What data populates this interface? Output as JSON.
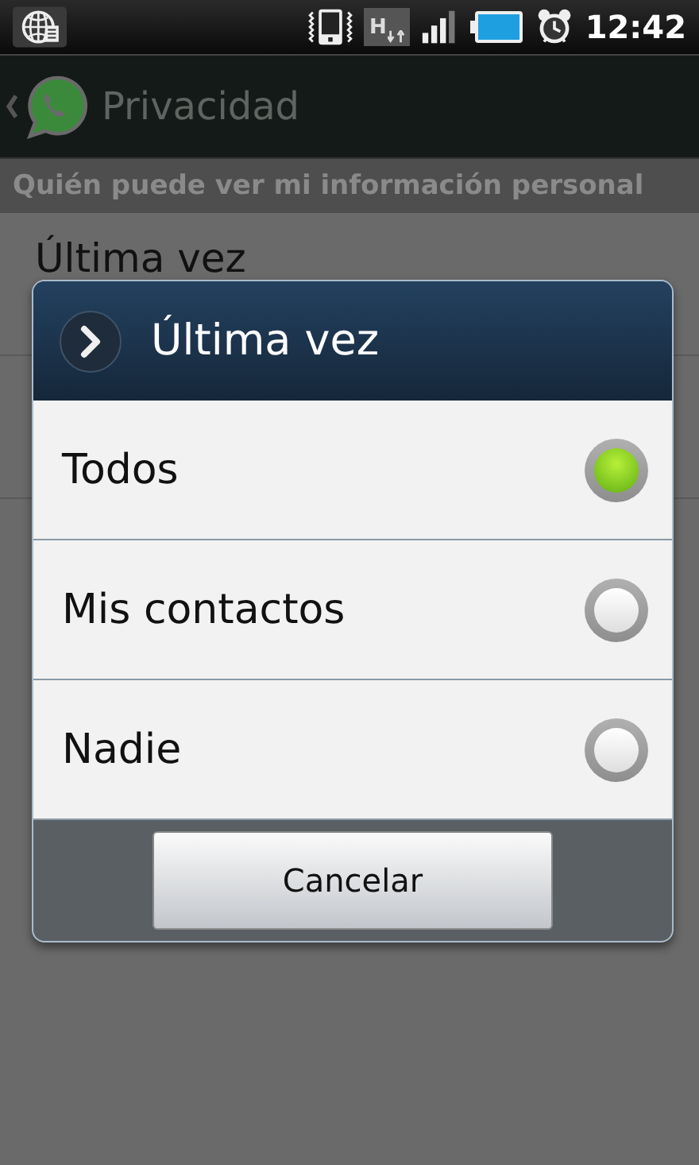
{
  "status_bar": {
    "network_type": "H",
    "time": "12:42"
  },
  "action_bar": {
    "title": "Privacidad"
  },
  "section": {
    "header": "Quién puede ver mi información personal"
  },
  "settings": [
    {
      "label": "Última vez"
    }
  ],
  "dialog": {
    "title": "Última vez",
    "options": [
      {
        "label": "Todos",
        "selected": true
      },
      {
        "label": "Mis contactos",
        "selected": false
      },
      {
        "label": "Nadie",
        "selected": false
      }
    ],
    "buttons": [
      "Cancelar"
    ]
  }
}
